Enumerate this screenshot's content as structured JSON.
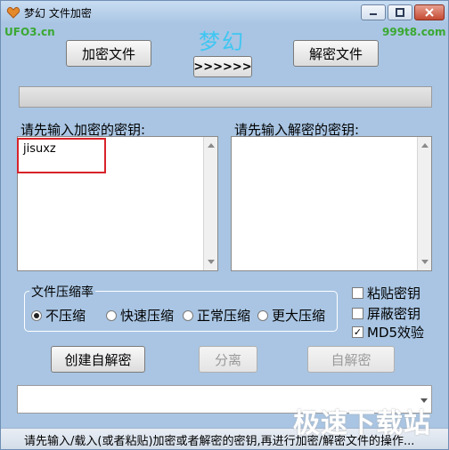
{
  "window": {
    "title": "梦幻 文件加密",
    "icon": "app-heart-icon"
  },
  "header": {
    "brand_left": "UFO3.cn",
    "brand_right": "999t8.com",
    "logo": "梦幻"
  },
  "toolbar": {
    "encrypt_label": "加密文件",
    "decrypt_label": "解密文件",
    "arrows_label": ">>>>>>"
  },
  "keys": {
    "encrypt_label": "请先输入加密的密钥:",
    "decrypt_label": "请先输入解密的密钥:",
    "encrypt_value": "jisuxz",
    "decrypt_value": ""
  },
  "compression": {
    "title": "文件压缩率",
    "options": [
      "不压缩",
      "快速压缩",
      "正常压缩",
      "更大压缩"
    ],
    "selected": "不压缩"
  },
  "checkboxes": {
    "paste_key": {
      "label": "粘贴密钥",
      "checked": false
    },
    "hide_key": {
      "label": "屏蔽密钥",
      "checked": false
    },
    "md5": {
      "label": "MD5效验",
      "checked": true
    }
  },
  "actions": {
    "create_self_decrypt": "创建自解密",
    "split": "分离",
    "self_decrypt": "自解密"
  },
  "status": {
    "message": "请先输入/载入(或者粘贴)加密或者解密的密钥,再进行加密/解密文件的操作..."
  },
  "watermark": "极速下载站",
  "colors": {
    "window_bg": "#a9c5e3",
    "brand_green": "#3aa832",
    "logo_cyan": "#3ec6f2",
    "highlight_red": "#d8232a"
  }
}
